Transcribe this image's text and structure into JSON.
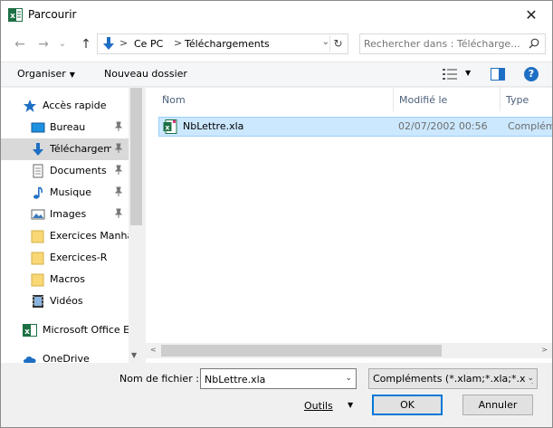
{
  "window": {
    "title": "Parcourir",
    "close_glyph": "✕"
  },
  "nav": {
    "back_glyph": "←",
    "forward_glyph": "→",
    "recent_glyph": "⌄",
    "up_glyph": "↑"
  },
  "address": {
    "crumbs": [
      "Ce PC",
      "Téléchargements"
    ],
    "sep_glyph": ">",
    "drop_glyph": "⌄",
    "refresh_glyph": "↻"
  },
  "search": {
    "placeholder": "Rechercher dans : Télécharge..."
  },
  "toolbar": {
    "organize_label": "Organiser",
    "new_folder_label": "Nouveau dossier",
    "caret_glyph": "▼",
    "help_glyph": "?"
  },
  "sidebar": {
    "items": [
      {
        "label": "Accès rapide",
        "icon": "star-icon"
      },
      {
        "label": "Bureau",
        "icon": "desktop-icon",
        "pinned": true
      },
      {
        "label": "Téléchargeme",
        "icon": "download-icon",
        "pinned": true,
        "selected": true
      },
      {
        "label": "Documents",
        "icon": "documents-icon",
        "pinned": true
      },
      {
        "label": "Musique",
        "icon": "music-icon",
        "pinned": true
      },
      {
        "label": "Images",
        "icon": "pictures-icon",
        "pinned": true
      },
      {
        "label": "Exercices Manha",
        "icon": "folder-icon"
      },
      {
        "label": "Exercices-R",
        "icon": "folder-icon"
      },
      {
        "label": "Macros",
        "icon": "folder-icon"
      },
      {
        "label": "Vidéos",
        "icon": "videos-icon"
      },
      {
        "label": "Microsoft Office E",
        "icon": "excel-icon"
      },
      {
        "label": "OneDrive",
        "icon": "onedrive-icon"
      }
    ]
  },
  "files": {
    "columns": [
      "Nom",
      "Modifié le",
      "Type"
    ],
    "sort_glyph": "^",
    "rows": [
      {
        "name": "NbLettre.xla",
        "modified": "02/07/2002 00:56",
        "type": "Compléments Microsoft Excel"
      }
    ]
  },
  "scroll": {
    "left_glyph": "<",
    "right_glyph": ">",
    "down_glyph": "▼"
  },
  "bottom": {
    "filename_label": "Nom de fichier :",
    "filename_value": "NbLettre.xla",
    "filter_value": "Compléments (*.xlam;*.xla;*.xll)",
    "dd_glyph": "⌄",
    "tools_label": "Outils",
    "tools_caret": "▼",
    "ok_label": "OK",
    "cancel_label": "Annuler"
  },
  "colors": {
    "accent": "#0078d7",
    "selection_bg": "#cce8ff",
    "selection_border": "#99d1ff",
    "folder": "#f8d775",
    "excel_green": "#1d7044"
  }
}
